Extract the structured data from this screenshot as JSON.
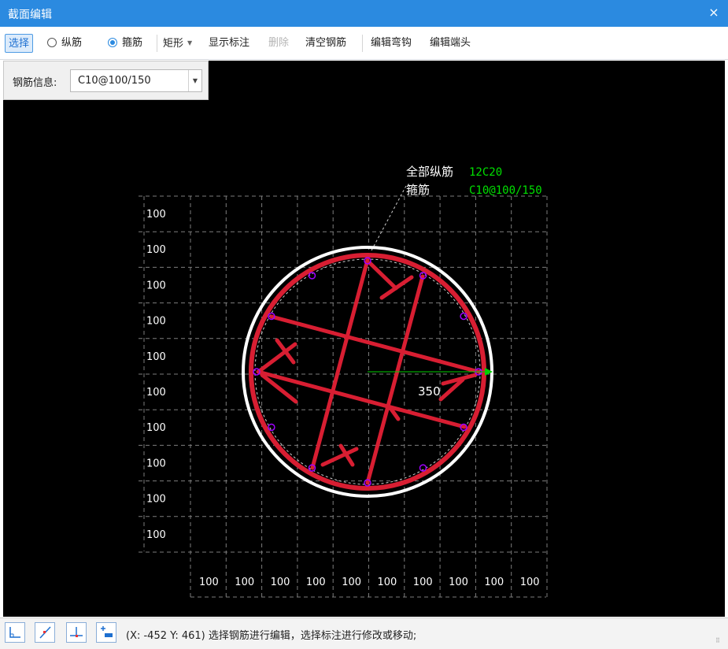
{
  "window": {
    "title": "截面编辑",
    "close_glyph": "×"
  },
  "toolbar": {
    "select": "选择",
    "longitudinal": "纵筋",
    "stirrup": "箍筋",
    "rect": "矩形",
    "show_dim": "显示标注",
    "delete": "删除",
    "clear": "清空钢筋",
    "edit_hook": "编辑弯钩",
    "edit_end": "编辑端头"
  },
  "info_panel": {
    "label": "钢筋信息:",
    "value": "C10@100/150"
  },
  "drawing": {
    "annotation": {
      "long_label": "全部纵筋",
      "long_value": "12C20",
      "stirrup_label": "箍筋",
      "stirrup_value": "C10@100/150"
    },
    "radius_text": "350",
    "grid_label": "100",
    "colors": {
      "background": "#000000",
      "section": "#ffffff",
      "rebar": "#d81e32",
      "bar_dot": "#a000ff",
      "grid": "#8a8a8a",
      "dimension": "#00d000",
      "annotation_value": "#00e000"
    }
  },
  "status": {
    "buttons": [
      "orthogonal-icon",
      "free-line-icon",
      "perpendicular-icon",
      "add-dimension-icon"
    ],
    "coords": "(X: -452 Y: 461)",
    "message": "选择钢筋进行编辑，选择标注进行修改或移动;"
  }
}
